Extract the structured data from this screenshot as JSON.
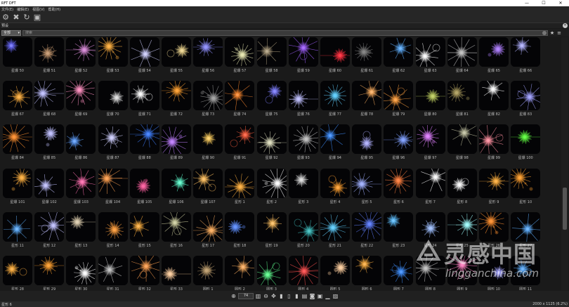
{
  "window": {
    "title": "RFT DFT",
    "controls": [
      "—",
      "☐",
      "✕"
    ]
  },
  "menu": [
    "文件(E)",
    "编辑(E)",
    "视图(V)",
    "帮助(H)"
  ],
  "toolbar": {
    "icons": [
      "gear-icon",
      "delete-icon",
      "refresh-icon",
      "fit-icon"
    ]
  },
  "panel": {
    "tab_label": "预设",
    "close_glyph": "✕"
  },
  "filter": {
    "category": "全部",
    "search_placeholder": "搜索"
  },
  "thumbnails": [
    {
      "label": "星爆 50",
      "color": "#6b6bff"
    },
    {
      "label": "星爆 51",
      "color": "#c89a70"
    },
    {
      "label": "星爆 52",
      "color": "#d88ad8"
    },
    {
      "label": "星爆 53",
      "color": "#ffb040"
    },
    {
      "label": "星爆 54",
      "color": "#d0d0ff"
    },
    {
      "label": "星爆 55",
      "color": "#f0d890"
    },
    {
      "label": "星爆 56",
      "color": "#9090ff"
    },
    {
      "label": "星爆 57",
      "color": "#e8e8b0"
    },
    {
      "label": "星爆 58",
      "color": "#b0a080"
    },
    {
      "label": "星爆 59",
      "color": "#a060ff"
    },
    {
      "label": "星爆 60",
      "color": "#ff3040"
    },
    {
      "label": "星爆 61",
      "color": "#808080"
    },
    {
      "label": "星爆 62",
      "color": "#60b0ff"
    },
    {
      "label": "星爆 63",
      "color": "#ffffff"
    },
    {
      "label": "星爆 64",
      "color": "#c0c0c0"
    },
    {
      "label": "星爆 65",
      "color": "#b080ff"
    },
    {
      "label": "星爆 66",
      "color": "#b0b0ff"
    },
    {
      "label": "星爆 67",
      "color": "#ffb040"
    },
    {
      "label": "星爆 68",
      "color": "#c0c0ff"
    },
    {
      "label": "星爆 69",
      "color": "#ff90c0"
    },
    {
      "label": "星爆 70",
      "color": "#e0e0e0"
    },
    {
      "label": "星爆 71",
      "color": "#ffffff"
    },
    {
      "label": "星爆 72",
      "color": "#ffa030"
    },
    {
      "label": "星爆 73",
      "color": "#a0a0a0"
    },
    {
      "label": "星爆 74",
      "color": "#ff8a30"
    },
    {
      "label": "星爆 75",
      "color": "#8080ff"
    },
    {
      "label": "星爆 76",
      "color": "#c0c0ff"
    },
    {
      "label": "星爆 77",
      "color": "#60d0ff"
    },
    {
      "label": "星爆 78",
      "color": "#ffb060"
    },
    {
      "label": "星爆 79",
      "color": "#ffa040"
    },
    {
      "label": "星爆 80",
      "color": "#c0d060"
    },
    {
      "label": "星爆 81",
      "color": "#b0a060"
    },
    {
      "label": "星爆 82",
      "color": "#ffffff"
    },
    {
      "label": "星爆 83",
      "color": "#a0a0ff"
    },
    {
      "label": "星爆 84",
      "color": "#ff9030"
    },
    {
      "label": "星爆 85",
      "color": "#c0c0ff"
    },
    {
      "label": "星爆 86",
      "color": "#60a0ff"
    },
    {
      "label": "星爆 87",
      "color": "#d0d0ff"
    },
    {
      "label": "星爆 88",
      "color": "#4080ff"
    },
    {
      "label": "星爆 89",
      "color": "#c080ff"
    },
    {
      "label": "星爆 90",
      "color": "#ffd060"
    },
    {
      "label": "星爆 91",
      "color": "#ff6040"
    },
    {
      "label": "星爆 92",
      "color": "#e0e0c0"
    },
    {
      "label": "星爆 93",
      "color": "#c0c0c0"
    },
    {
      "label": "星爆 94",
      "color": "#4090ff"
    },
    {
      "label": "星爆 95",
      "color": "#b0b0ff"
    },
    {
      "label": "星爆 96",
      "color": "#80a0ff"
    },
    {
      "label": "星爆 97",
      "color": "#e080ff"
    },
    {
      "label": "星爆 98",
      "color": "#c0c0a0"
    },
    {
      "label": "星爆 99",
      "color": "#ff90a0"
    },
    {
      "label": "星爆 100",
      "color": "#60ff40"
    },
    {
      "label": "星爆 101",
      "color": "#ffb040"
    },
    {
      "label": "星爆 102",
      "color": "#c0c0ff"
    },
    {
      "label": "星爆 103",
      "color": "#ff70b0"
    },
    {
      "label": "星爆 104",
      "color": "#ffa050"
    },
    {
      "label": "星爆 105",
      "color": "#ff60a0"
    },
    {
      "label": "星爆 106",
      "color": "#60ffd0"
    },
    {
      "label": "星爆 107",
      "color": "#ffc060"
    },
    {
      "label": "星形 1",
      "color": "#ffb040"
    },
    {
      "label": "星形 2",
      "color": "#ffffff"
    },
    {
      "label": "星形 3",
      "color": "#e0e0e0"
    },
    {
      "label": "星形 4",
      "color": "#ffa030"
    },
    {
      "label": "星形 5",
      "color": "#a0b0ff"
    },
    {
      "label": "星形 6",
      "color": "#ff8040"
    },
    {
      "label": "星形 7",
      "color": "#ffffff"
    },
    {
      "label": "星形 8",
      "color": "#ffffff"
    },
    {
      "label": "星形 9",
      "color": "#ffb040"
    },
    {
      "label": "星形 10",
      "color": "#ffa030"
    },
    {
      "label": "星形 11",
      "color": "#60b0ff"
    },
    {
      "label": "星形 12",
      "color": "#c0c0ff"
    },
    {
      "label": "星形 13",
      "color": "#e0d0b0"
    },
    {
      "label": "星形 14",
      "color": "#ffa040"
    },
    {
      "label": "星形 15",
      "color": "#ffb040"
    },
    {
      "label": "星形 16",
      "color": "#d0d0a0"
    },
    {
      "label": "星形 17",
      "color": "#ffb060"
    },
    {
      "label": "星形 18",
      "color": "#6090ff"
    },
    {
      "label": "星形 19",
      "color": "#ffc060"
    },
    {
      "label": "星形 20",
      "color": "#40c0c0"
    },
    {
      "label": "星形 21",
      "color": "#60d0ff"
    },
    {
      "label": "星形 22",
      "color": "#6080ff"
    },
    {
      "label": "星形 23",
      "color": "#60c0ff"
    },
    {
      "label": "星形 24",
      "color": "#a0c0ff"
    },
    {
      "label": "星形 25",
      "color": "#a0ffff"
    },
    {
      "label": "星形 26",
      "color": "#ff9030"
    },
    {
      "label": "星形 27",
      "color": "#60b0ff"
    },
    {
      "label": "星形 28",
      "color": "#ffb040"
    },
    {
      "label": "星形 29",
      "color": "#ffa030"
    },
    {
      "label": "星形 30",
      "color": "#ffffff"
    },
    {
      "label": "星形 31",
      "color": "#c0c0c0"
    },
    {
      "label": "星形 32",
      "color": "#ffa050"
    },
    {
      "label": "星形 33",
      "color": "#ffd0a0"
    },
    {
      "label": "圆形 1",
      "color": "#c0a070"
    },
    {
      "label": "圆形 2",
      "color": "#ffb060"
    },
    {
      "label": "圆形 3",
      "color": "#60ff90"
    },
    {
      "label": "圆形 4",
      "color": "#ff5050"
    },
    {
      "label": "圆形 5",
      "color": "#ffd0a0"
    },
    {
      "label": "圆形 6",
      "color": "#ffb040"
    },
    {
      "label": "圆形 7",
      "color": "#4090ff"
    },
    {
      "label": "圆形 8",
      "color": "#c0c0c0"
    },
    {
      "label": "圆形 9",
      "color": "#ff80c0"
    },
    {
      "label": "圆形 10",
      "color": "#a0a0ff"
    },
    {
      "label": "圆形 11",
      "color": "#60b0ff"
    }
  ],
  "bottombar": {
    "zoom_value": "74",
    "icons": [
      "zoom-in-icon",
      "zoom-field",
      "grid-view-icon",
      "zoom-out-icon",
      "pan-icon",
      "view-mode-1-icon",
      "view-mode-2-icon",
      "view-mode-3-icon",
      "document-icon",
      "camera-icon",
      "frame-icon",
      "histogram-icon",
      "image-icon"
    ]
  },
  "status": {
    "left": "星形 6",
    "right": "2000 x 1125 (6.2%)"
  },
  "watermark": {
    "cn": "灵感中国",
    "url": "lingganchina.com"
  }
}
